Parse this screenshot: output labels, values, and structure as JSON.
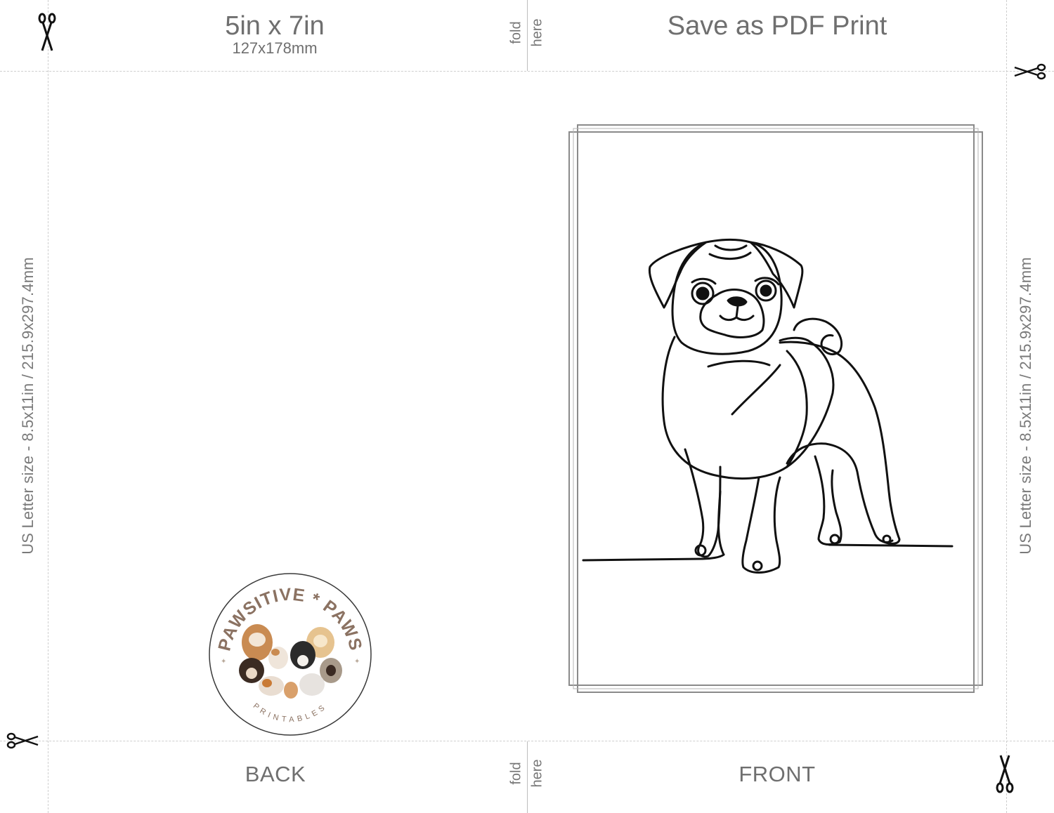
{
  "card_size": {
    "inches": "5in x 7in",
    "mm": "127x178mm"
  },
  "fold_label": {
    "top": "fold",
    "bottom": "here"
  },
  "save_label": "Save as PDF Print",
  "paper_size_label": "US Letter size - 8.5x11in / 215.9x297.4mm",
  "panels": {
    "back": "BACK",
    "front": "FRONT"
  },
  "logo": {
    "brand_top": "PAWSITIVE * PAWS",
    "brand_bottom": "PRINTABLES"
  },
  "front_art": {
    "icon": "pug-line-drawing"
  },
  "colors": {
    "text": "#6f6f6f",
    "guide": "#cfcfcf",
    "logo_text": "#8b7262"
  }
}
